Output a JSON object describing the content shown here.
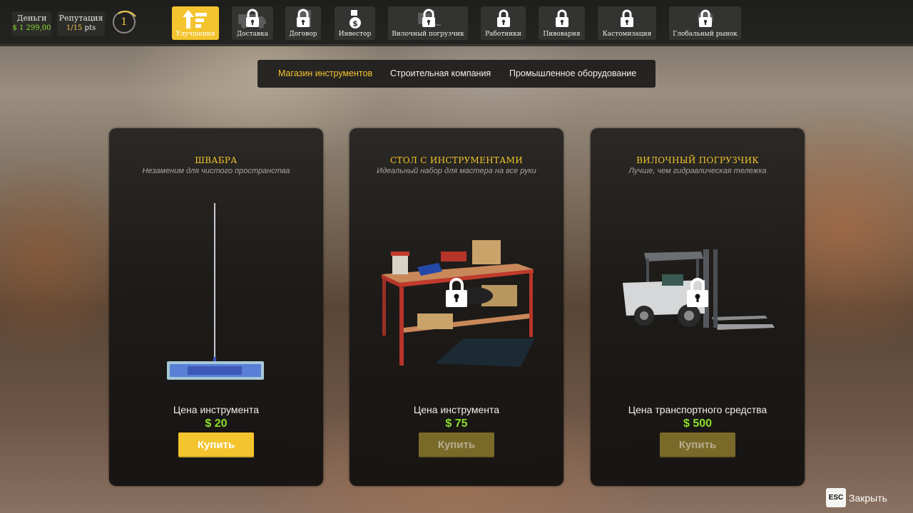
{
  "hud": {
    "money_label": "Деньги",
    "money_value": "$ 1 299,00",
    "reputation_label": "Репутация",
    "reputation_value": "1/15",
    "reputation_unit": "pts",
    "level": "1"
  },
  "nav": {
    "tabs": [
      {
        "label": "Улучшения",
        "icon": "upgrade-arrows-icon",
        "active": true,
        "locked": false
      },
      {
        "label": "Доставка",
        "icon": "truck-icon",
        "active": false,
        "locked": true
      },
      {
        "label": "Договор",
        "icon": "contract-icon",
        "active": false,
        "locked": true
      },
      {
        "label": "Инвестор",
        "icon": "money-bag-icon",
        "active": false,
        "locked": false
      },
      {
        "label": "Вилочный погрузчик",
        "icon": "forklift-icon",
        "active": false,
        "locked": true
      },
      {
        "label": "Работники",
        "icon": "workers-icon",
        "active": false,
        "locked": true
      },
      {
        "label": "Пивоварня",
        "icon": "brewery-icon",
        "active": false,
        "locked": true
      },
      {
        "label": "Кастомизация",
        "icon": "customization-icon",
        "active": false,
        "locked": true
      },
      {
        "label": "Глобальный рынок",
        "icon": "globe-icon",
        "active": false,
        "locked": true
      }
    ]
  },
  "subtabs": [
    {
      "label": "Магазин инструментов",
      "active": true
    },
    {
      "label": "Строительная компания",
      "active": false
    },
    {
      "label": "Промышленное оборудование",
      "active": false
    }
  ],
  "cards": [
    {
      "title": "ШВАБРА",
      "subtitle": "Незаменим для чистого пространства",
      "price_label": "Цена инструмента",
      "price": "$ 20",
      "button": "Купить",
      "enabled": true,
      "locked": false,
      "image": "mop-image"
    },
    {
      "title": "СТОЛ С ИНСТРУМЕНТАМИ",
      "subtitle": "Идеальный набор для мастера на все руки",
      "price_label": "Цена инструмента",
      "price": "$ 75",
      "button": "Купить",
      "enabled": false,
      "locked": true,
      "image": "workbench-image"
    },
    {
      "title": "ВИЛОЧНЫЙ ПОГРУЗЧИК",
      "subtitle": "Лучше, чем гидравлическая тележка",
      "price_label": "Цена транспортного средства",
      "price": "$ 500",
      "button": "Купить",
      "enabled": false,
      "locked": true,
      "image": "forklift-image"
    }
  ],
  "close": {
    "key": "ESC",
    "label": "Закрыть"
  },
  "colors": {
    "accent": "#f4c42e",
    "money": "#8fdf2e",
    "panel": "#1c1b1a"
  }
}
